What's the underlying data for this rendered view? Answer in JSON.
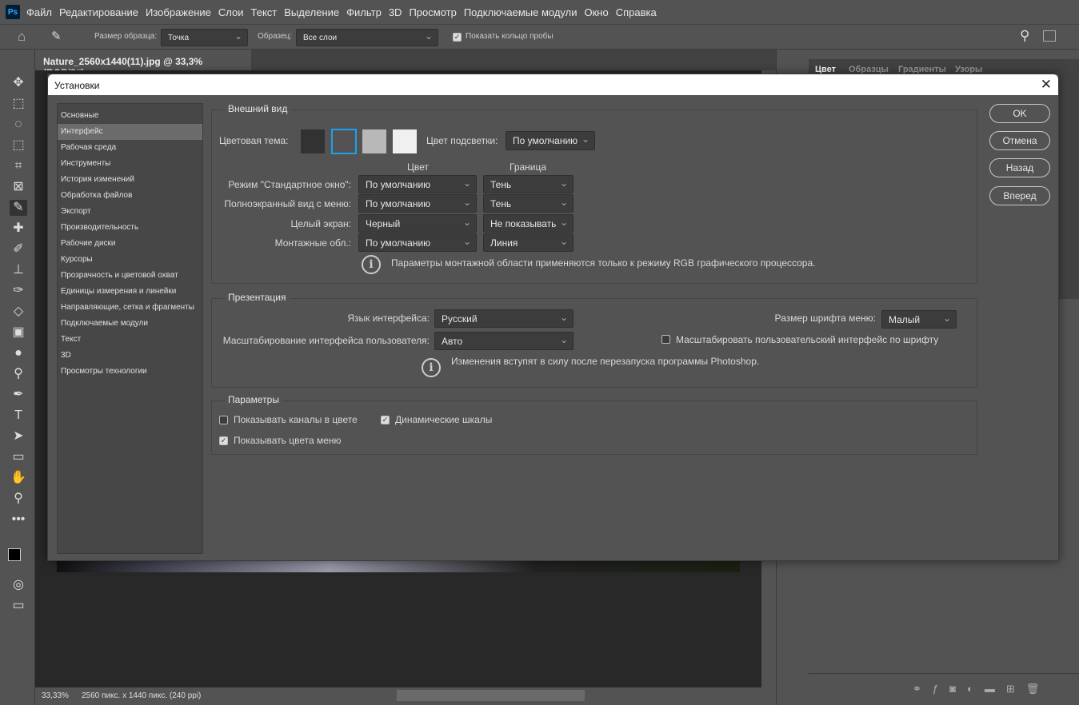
{
  "menu": {
    "logo": "Ps",
    "items": [
      "Файл",
      "Редактирование",
      "Изображение",
      "Слои",
      "Текст",
      "Выделение",
      "Фильтр",
      "3D",
      "Просмотр",
      "Подключаемые модули",
      "Окно",
      "Справка"
    ]
  },
  "options": {
    "sample_size_label": "Размер образца:",
    "sample_size_value": "Точка",
    "sample_label": "Образец:",
    "sample_value": "Все слои",
    "show_ring_label": "Показать кольцо пробы",
    "show_ring_checked": true
  },
  "document": {
    "tab_title": "Nature_2560x1440(11).jpg @ 33,3% (RGB/8#)",
    "zoom": "33,33%",
    "info": "2560 пикс. x 1440 пикс. (240 ppi)"
  },
  "right_panel": {
    "tabs": [
      "Цвет",
      "Образцы",
      "Градиенты",
      "Узоры"
    ],
    "active_tab": "Цвет"
  },
  "dialog": {
    "title": "Установки",
    "sidebar": [
      "Основные",
      "Интерфейс",
      "Рабочая среда",
      "Инструменты",
      "История изменений",
      "Обработка файлов",
      "Экспорт",
      "Производительность",
      "Рабочие диски",
      "Курсоры",
      "Прозрачность и цветовой охват",
      "Единицы измерения и линейки",
      "Направляющие, сетка и фрагменты",
      "Подключаемые модули",
      "Текст",
      "3D",
      "Просмотры технологии"
    ],
    "sidebar_active": "Интерфейс",
    "buttons": {
      "ok": "OK",
      "cancel": "Отмена",
      "back": "Назад",
      "forward": "Вперед"
    },
    "appearance": {
      "title": "Внешний вид",
      "theme_label": "Цветовая тема:",
      "theme_colors": [
        "#323232",
        "#535353",
        "#b8b8b8",
        "#f0f0f0"
      ],
      "theme_selected_index": 1,
      "highlight_label": "Цвет подсветки:",
      "highlight_value": "По умолчанию",
      "col_color": "Цвет",
      "col_border": "Граница",
      "rows": [
        {
          "label": "Режим \"Стандартное окно\":",
          "color": "По умолчанию",
          "border": "Тень"
        },
        {
          "label": "Полноэкранный вид с меню:",
          "color": "По умолчанию",
          "border": "Тень"
        },
        {
          "label": "Целый экран:",
          "color": "Черный",
          "border": "Не показывать"
        },
        {
          "label": "Монтажные обл.:",
          "color": "По умолчанию",
          "border": "Линия"
        }
      ],
      "note": "Параметры монтажной области применяются только к режиму RGB графического процессора."
    },
    "presentation": {
      "title": "Презентация",
      "lang_label": "Язык интерфейса:",
      "lang_value": "Русский",
      "font_label": "Размер шрифта меню:",
      "font_value": "Малый",
      "scale_label": "Масштабирование интерфейса пользователя:",
      "scale_value": "Авто",
      "scale_font_label": "Масштабировать пользовательский интерфейс по шрифту",
      "scale_font_checked": false,
      "note": "Изменения вступят в силу после перезапуска программы Photoshop."
    },
    "params": {
      "title": "Параметры",
      "channels_label": "Показывать каналы в цвете",
      "channels_checked": false,
      "dynamic_label": "Динамические шкалы",
      "dynamic_checked": true,
      "menu_colors_label": "Показывать цвета меню",
      "menu_colors_checked": true
    }
  }
}
